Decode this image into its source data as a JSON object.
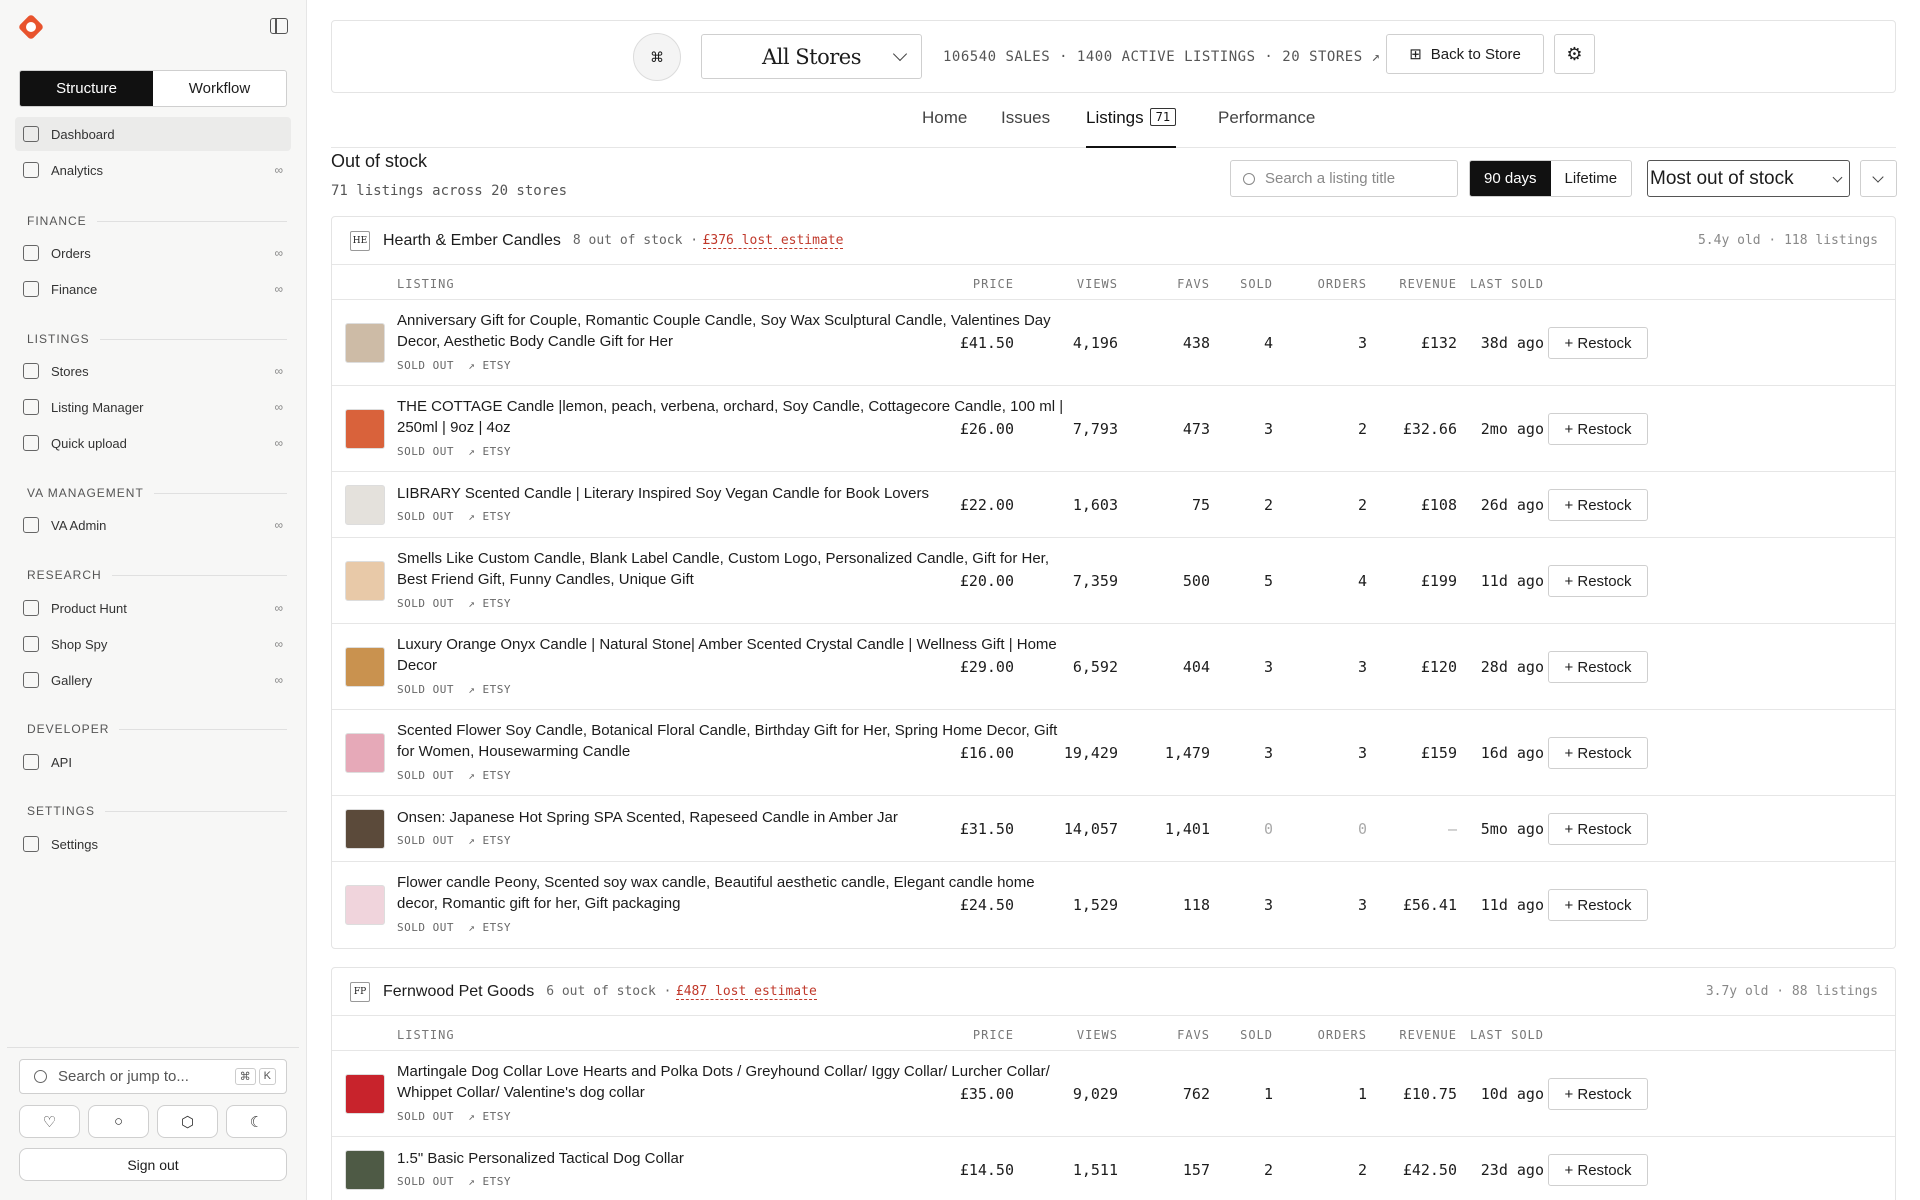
{
  "sidebar": {
    "segments": [
      "Structure",
      "Workflow"
    ],
    "nav": [
      {
        "label": "Dashboard",
        "active": true,
        "inf": ""
      },
      {
        "label": "Analytics",
        "inf": "∞"
      }
    ],
    "sections": [
      {
        "title": "FINANCE",
        "items": [
          {
            "label": "Orders",
            "inf": "∞"
          },
          {
            "label": "Finance",
            "inf": "∞"
          }
        ]
      },
      {
        "title": "LISTINGS",
        "items": [
          {
            "label": "Stores",
            "inf": "∞"
          },
          {
            "label": "Listing Manager",
            "inf": "∞"
          },
          {
            "label": "Quick upload",
            "inf": "∞"
          }
        ]
      },
      {
        "title": "VA MANAGEMENT",
        "items": [
          {
            "label": "VA Admin",
            "inf": "∞"
          }
        ]
      },
      {
        "title": "RESEARCH",
        "items": [
          {
            "label": "Product Hunt",
            "inf": "∞"
          },
          {
            "label": "Shop Spy",
            "inf": "∞"
          },
          {
            "label": "Gallery",
            "inf": "∞"
          }
        ]
      },
      {
        "title": "DEVELOPER",
        "items": [
          {
            "label": "API",
            "inf": ""
          }
        ]
      },
      {
        "title": "SETTINGS",
        "items": [
          {
            "label": "Settings",
            "inf": ""
          }
        ]
      }
    ],
    "search_placeholder": "Search or jump to...",
    "kbd": [
      "⌘",
      "K"
    ],
    "sign_out": "Sign out"
  },
  "topbar": {
    "store_select": "All Stores",
    "stats": "106540 SALES · 1400 ACTIVE LISTINGS · 20 STORES ↗",
    "back_label": "Back to Store"
  },
  "tabs": [
    {
      "label": "Home"
    },
    {
      "label": "Issues"
    },
    {
      "label": "Listings",
      "badge": "71",
      "active": true
    },
    {
      "label": "Performance"
    }
  ],
  "page": {
    "title": "Out of stock",
    "subtitle": "71 listings across 20 stores",
    "search_placeholder": "Search a listing title",
    "ranges": [
      "90 days",
      "Lifetime"
    ],
    "sort": "Most out of stock"
  },
  "columns": [
    "LISTING",
    "PRICE",
    "VIEWS",
    "FAVS",
    "SOLD",
    "ORDERS",
    "REVENUE",
    "LAST SOLD"
  ],
  "restock_label": "+ Restock",
  "sold_out": "SOLD OUT",
  "source": "↗ ETSY",
  "groups": [
    {
      "initials": "HE",
      "name": "Hearth & Ember Candles",
      "out": "8 out of stock ·",
      "lost": "£376 lost estimate",
      "meta": "5.4y old · 118 listings",
      "rows": [
        {
          "title": "Anniversary Gift for Couple, Romantic Couple Candle, Soy Wax Sculptural Candle, Valentines Day Decor, Aesthetic Body Candle Gift for Her",
          "price": "£41.50",
          "views": "4,196",
          "favs": "438",
          "sold": "4",
          "orders": "3",
          "revenue": "£132",
          "last": "38d ago",
          "thumb": "#cdbba6"
        },
        {
          "title": "THE COTTAGE Candle |lemon, peach, verbena, orchard, Soy Candle, Cottagecore Candle, 100 ml | 250ml | 9oz | 4oz",
          "price": "£26.00",
          "views": "7,793",
          "favs": "473",
          "sold": "3",
          "orders": "2",
          "revenue": "£32.66",
          "last": "2mo ago",
          "thumb": "#d9623b"
        },
        {
          "title": "LIBRARY Scented Candle | Literary Inspired Soy Vegan Candle for Book Lovers",
          "price": "£22.00",
          "views": "1,603",
          "favs": "75",
          "sold": "2",
          "orders": "2",
          "revenue": "£108",
          "last": "26d ago",
          "thumb": "#e4e1dc"
        },
        {
          "title": "Smells Like Custom Candle, Blank Label Candle, Custom Logo, Personalized Candle, Gift for Her, Best Friend Gift, Funny Candles, Unique Gift",
          "price": "£20.00",
          "views": "7,359",
          "favs": "500",
          "sold": "5",
          "orders": "4",
          "revenue": "£199",
          "last": "11d ago",
          "thumb": "#e8c9a8"
        },
        {
          "title": "Luxury Orange Onyx Candle | Natural Stone| Amber Scented Crystal Candle | Wellness Gift | Home Decor",
          "price": "£29.00",
          "views": "6,592",
          "favs": "404",
          "sold": "3",
          "orders": "3",
          "revenue": "£120",
          "last": "28d ago",
          "thumb": "#c9924f"
        },
        {
          "title": "Scented Flower Soy Candle, Botanical Floral Candle, Birthday Gift for Her, Spring Home Decor, Gift for Women, Housewarming Candle",
          "price": "£16.00",
          "views": "19,429",
          "favs": "1,479",
          "sold": "3",
          "orders": "3",
          "revenue": "£159",
          "last": "16d ago",
          "thumb": "#e6a9b8"
        },
        {
          "title": "Onsen: Japanese Hot Spring SPA Scented, Rapeseed Candle in Amber Jar",
          "price": "£31.50",
          "views": "14,057",
          "favs": "1,401",
          "sold": "0",
          "orders": "0",
          "revenue": "—",
          "last": "5mo ago",
          "thumb": "#5b4a3a",
          "dim": true
        },
        {
          "title": "Flower candle Peony, Scented soy wax candle, Beautiful aesthetic candle, Elegant candle home decor, Romantic gift for her, Gift packaging",
          "price": "£24.50",
          "views": "1,529",
          "favs": "118",
          "sold": "3",
          "orders": "3",
          "revenue": "£56.41",
          "last": "11d ago",
          "thumb": "#f0d4dc"
        }
      ]
    },
    {
      "initials": "FP",
      "name": "Fernwood Pet Goods",
      "out": "6 out of stock ·",
      "lost": "£487 lost estimate",
      "meta": "3.7y old · 88 listings",
      "rows": [
        {
          "title": "Martingale Dog Collar Love Hearts and Polka Dots / Greyhound Collar/ Iggy Collar/ Lurcher Collar/ Whippet Collar/ Valentine's dog collar",
          "price": "£35.00",
          "views": "9,029",
          "favs": "762",
          "sold": "1",
          "orders": "1",
          "revenue": "£10.75",
          "last": "10d ago",
          "thumb": "#c8232c"
        },
        {
          "title": "1.5\" Basic Personalized Tactical Dog Collar",
          "price": "£14.50",
          "views": "1,511",
          "favs": "157",
          "sold": "2",
          "orders": "2",
          "revenue": "£42.50",
          "last": "23d ago",
          "thumb": "#4e5a45"
        }
      ]
    }
  ]
}
